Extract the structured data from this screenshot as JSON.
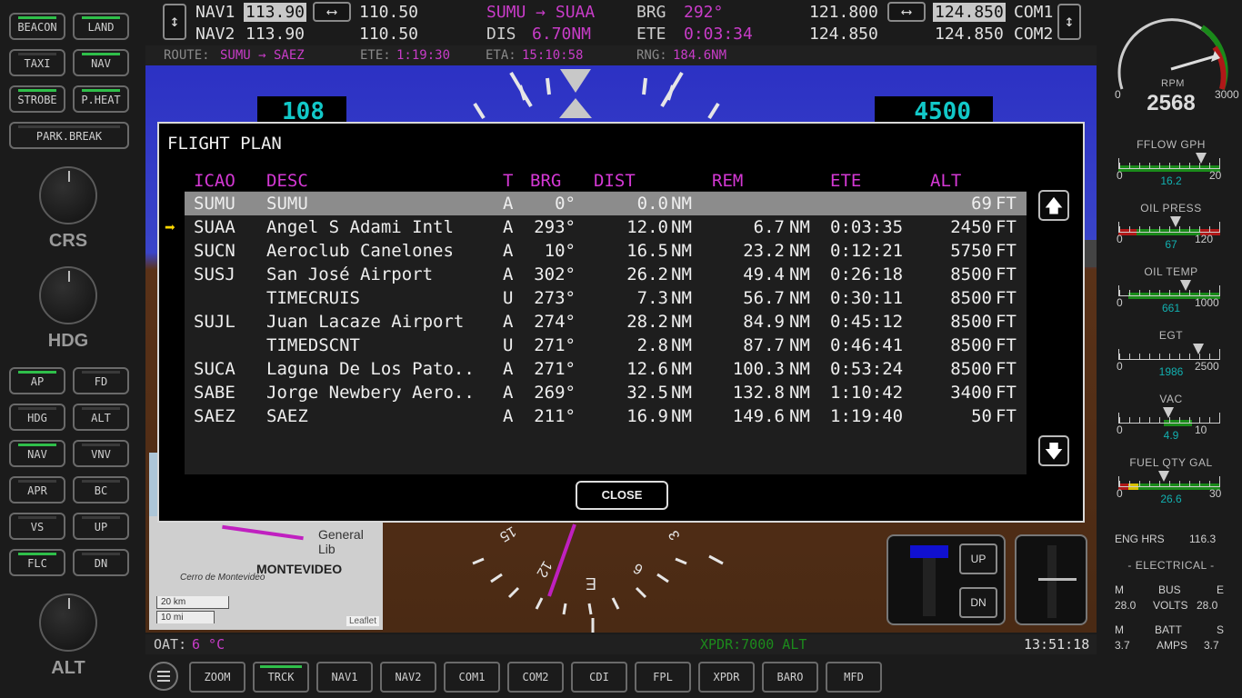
{
  "left": {
    "buttons": [
      {
        "label": "BEACON",
        "on": true
      },
      {
        "label": "LAND",
        "on": true
      },
      {
        "label": "TAXI",
        "on": false
      },
      {
        "label": "NAV",
        "on": true
      },
      {
        "label": "STROBE",
        "on": true
      },
      {
        "label": "P.HEAT",
        "on": true
      },
      {
        "label": "PARK.BREAK",
        "on": false
      }
    ],
    "knobs": [
      "CRS",
      "HDG",
      "ALT"
    ],
    "ap_buttons": [
      {
        "label": "AP",
        "on": true
      },
      {
        "label": "FD",
        "on": false
      },
      {
        "label": "HDG",
        "on": false
      },
      {
        "label": "ALT",
        "on": false
      },
      {
        "label": "NAV",
        "on": true
      },
      {
        "label": "VNV",
        "on": false
      },
      {
        "label": "APR",
        "on": false
      },
      {
        "label": "BC",
        "on": false
      },
      {
        "label": "VS",
        "on": false
      },
      {
        "label": "UP",
        "on": false
      },
      {
        "label": "FLC",
        "on": true
      },
      {
        "label": "DN",
        "on": false
      }
    ]
  },
  "radio": {
    "nav1_label": "NAV1",
    "nav1_active": "113.90",
    "nav1_standby": "110.50",
    "nav2_label": "NAV2",
    "nav2_active": "113.90",
    "nav2_standby": "110.50",
    "leg": "SUMU → SUAA",
    "dis_label": "DIS",
    "dis": "6.70NM",
    "brg_label": "BRG",
    "brg": "292°",
    "ete_label": "ETE",
    "ete": "0:03:34",
    "com1_standby": "121.800",
    "com1_active": "124.850",
    "com1_label": "COM1",
    "com2_standby": "124.850",
    "com2_active": "124.850",
    "com2_label": "COM2",
    "swap_icon": "⟷",
    "updown_icon": "↕"
  },
  "route": {
    "route_label": "ROUTE:",
    "route": "SUMU → SAEZ",
    "ete_label": "ETE:",
    "ete": "1:19:30",
    "eta_label": "ETA:",
    "eta": "15:10:58",
    "rng_label": "RNG:",
    "rng": "184.6NM"
  },
  "pfd": {
    "airspeed": "108",
    "altitude": "4500",
    "map": {
      "scale_km": "20 km",
      "scale_mi": "10 mi",
      "city": "MONTEVIDEO",
      "place": "Cerro de Montevideo",
      "airport": "General Lib",
      "attribution": "Leaflet"
    },
    "compass": {
      "labels": [
        "15",
        "12",
        "E",
        "6",
        "3"
      ]
    },
    "buttons": {
      "up": "UP",
      "dn": "DN"
    }
  },
  "flight_plan": {
    "title": "FLIGHT PLAN",
    "headers": {
      "icao": "ICAO",
      "desc": "DESC",
      "t": "T",
      "brg": "BRG",
      "dist": "DIST",
      "rem": "REM",
      "ete": "ETE",
      "alt": "ALT"
    },
    "rows": [
      {
        "icao": "SUMU",
        "desc": "SUMU",
        "t": "A",
        "brg": "0°",
        "dist": "0.0",
        "du": "NM",
        "rem": "",
        "ru": "",
        "ete": "",
        "alt": "69",
        "au": "FT"
      },
      {
        "icao": "SUAA",
        "desc": "Angel S Adami Intl",
        "t": "A",
        "brg": "293°",
        "dist": "12.0",
        "du": "NM",
        "rem": "6.7",
        "ru": "NM",
        "ete": "0:03:35",
        "alt": "2450",
        "au": "FT"
      },
      {
        "icao": "SUCN",
        "desc": "Aeroclub Canelones",
        "t": "A",
        "brg": "10°",
        "dist": "16.5",
        "du": "NM",
        "rem": "23.2",
        "ru": "NM",
        "ete": "0:12:21",
        "alt": "5750",
        "au": "FT"
      },
      {
        "icao": "SUSJ",
        "desc": "San José Airport",
        "t": "A",
        "brg": "302°",
        "dist": "26.2",
        "du": "NM",
        "rem": "49.4",
        "ru": "NM",
        "ete": "0:26:18",
        "alt": "8500",
        "au": "FT"
      },
      {
        "icao": "",
        "desc": "TIMECRUIS",
        "t": "U",
        "brg": "273°",
        "dist": "7.3",
        "du": "NM",
        "rem": "56.7",
        "ru": "NM",
        "ete": "0:30:11",
        "alt": "8500",
        "au": "FT"
      },
      {
        "icao": "SUJL",
        "desc": "Juan Lacaze Airport",
        "t": "A",
        "brg": "274°",
        "dist": "28.2",
        "du": "NM",
        "rem": "84.9",
        "ru": "NM",
        "ete": "0:45:12",
        "alt": "8500",
        "au": "FT"
      },
      {
        "icao": "",
        "desc": "TIMEDSCNT",
        "t": "U",
        "brg": "271°",
        "dist": "2.8",
        "du": "NM",
        "rem": "87.7",
        "ru": "NM",
        "ete": "0:46:41",
        "alt": "8500",
        "au": "FT"
      },
      {
        "icao": "SUCA",
        "desc": "Laguna De Los Pato..",
        "t": "A",
        "brg": "271°",
        "dist": "12.6",
        "du": "NM",
        "rem": "100.3",
        "ru": "NM",
        "ete": "0:53:24",
        "alt": "8500",
        "au": "FT"
      },
      {
        "icao": "SABE",
        "desc": "Jorge Newbery Aero..",
        "t": "A",
        "brg": "269°",
        "dist": "32.5",
        "du": "NM",
        "rem": "132.8",
        "ru": "NM",
        "ete": "1:10:42",
        "alt": "3400",
        "au": "FT"
      },
      {
        "icao": "SAEZ",
        "desc": "SAEZ",
        "t": "A",
        "brg": "211°",
        "dist": "16.9",
        "du": "NM",
        "rem": "149.6",
        "ru": "NM",
        "ete": "1:19:40",
        "alt": "50",
        "au": "FT"
      }
    ],
    "selected_index": 0,
    "active_index": 1,
    "active_arrow": "➡",
    "scroll_up": "🡅",
    "scroll_down": "🡇",
    "close": "CLOSE"
  },
  "status": {
    "oat_label": "OAT:",
    "oat": "6 °C",
    "xpdr": "XPDR:7000 ALT",
    "clock": "13:51:18"
  },
  "softkeys": [
    {
      "label": "ZOOM",
      "on": false
    },
    {
      "label": "TRCK",
      "on": true
    },
    {
      "label": "NAV1",
      "on": false
    },
    {
      "label": "NAV2",
      "on": false
    },
    {
      "label": "COM1",
      "on": false
    },
    {
      "label": "COM2",
      "on": false
    },
    {
      "label": "CDI",
      "on": false
    },
    {
      "label": "FPL",
      "on": false
    },
    {
      "label": "XPDR",
      "on": false
    },
    {
      "label": "BARO",
      "on": false
    },
    {
      "label": "MFD",
      "on": false
    }
  ],
  "engine": {
    "rpm": {
      "label": "RPM",
      "value": "2568",
      "min": "0",
      "max": "3000"
    },
    "gauges": [
      {
        "label": "FFLOW GPH",
        "value": "16.2",
        "min": "0",
        "max": "20",
        "level": 0.81
      },
      {
        "label": "OIL PRESS",
        "value": "67",
        "min": "0",
        "max": "120",
        "level": 0.56
      },
      {
        "label": "OIL TEMP",
        "value": "661",
        "min": "0",
        "max": "1000",
        "level": 0.66
      },
      {
        "label": "EGT",
        "value": "1986",
        "min": "0",
        "max": "2500",
        "level": 0.79
      },
      {
        "label": "VAC",
        "value": "4.9",
        "min": "0",
        "max": "10",
        "level": 0.49
      },
      {
        "label": "FUEL QTY GAL",
        "value": "26.6",
        "min": "0",
        "max": "30",
        "level": 0.45
      }
    ],
    "eng_hrs_label": "ENG HRS",
    "eng_hrs": "116.3",
    "electrical_title": "- ELECTRICAL -",
    "m": "M",
    "bus": "BUS",
    "e": "E",
    "volts": "VOLTS",
    "volt_m": "28.0",
    "volt_e": "28.0",
    "batt": "BATT",
    "s": "S",
    "amps": "AMPS",
    "amp_m": "3.7",
    "amp_s": "3.7"
  }
}
